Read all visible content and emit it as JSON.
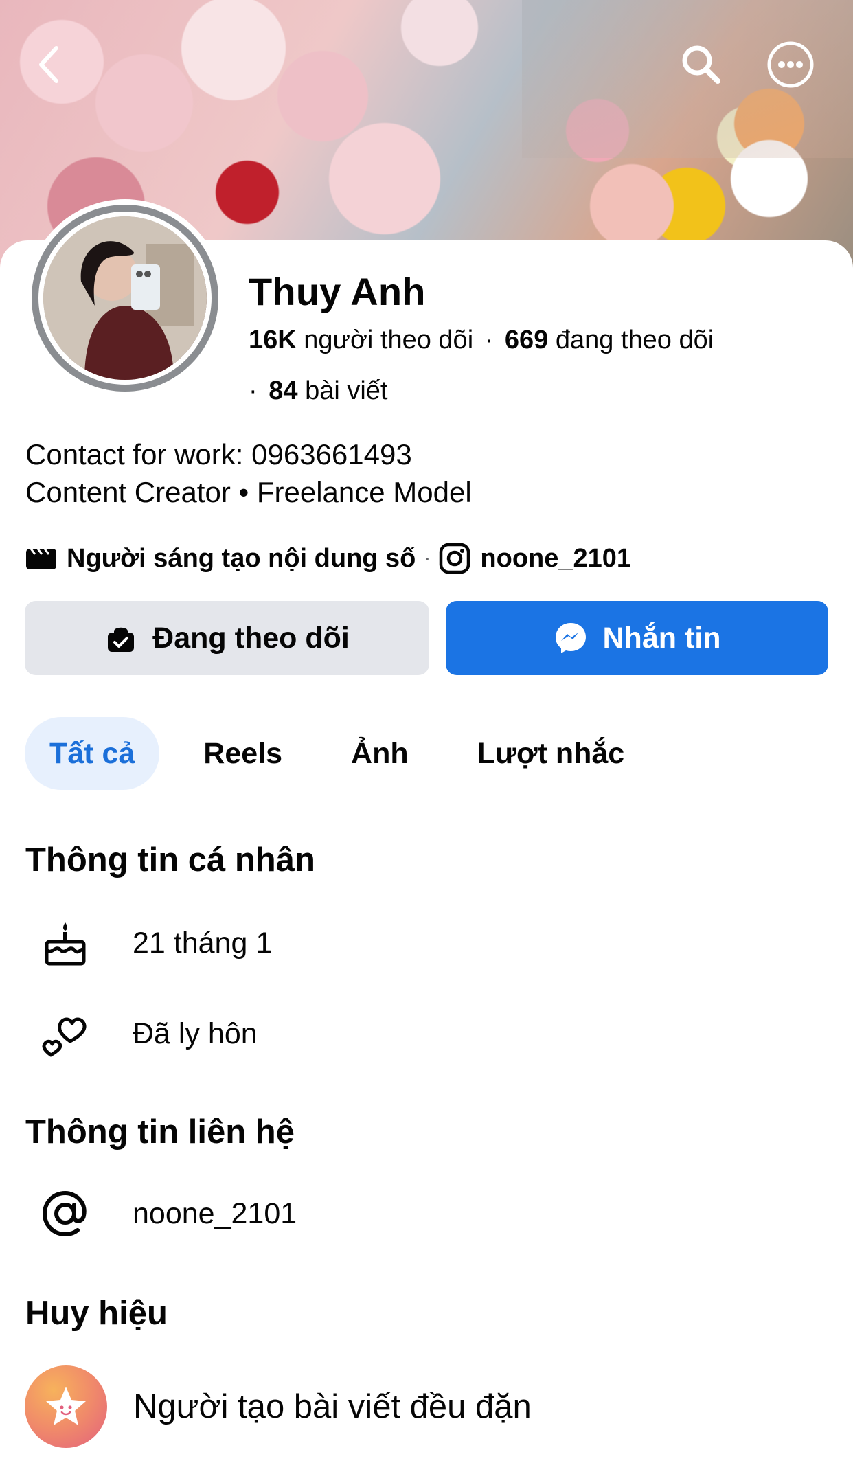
{
  "header": {
    "back_icon": "chevron-left-icon",
    "search_icon": "search-icon",
    "more_icon": "more-horizontal-icon"
  },
  "profile": {
    "name": "Thuy Anh",
    "followers_count": "16K",
    "followers_label": "người theo dõi",
    "following_count": "669",
    "following_label": "đang theo dõi",
    "posts_count": "84",
    "posts_label": "bài viết"
  },
  "bio": {
    "line1": "Contact for work: 0963661493",
    "line2": "Content Creator • Freelance Model"
  },
  "meta": {
    "creator_label": "Người sáng tạo nội dung số",
    "instagram_handle": "noone_2101"
  },
  "actions": {
    "following_label": "Đang theo dõi",
    "message_label": "Nhắn tin"
  },
  "tabs": [
    {
      "label": "Tất cả",
      "active": true
    },
    {
      "label": "Reels",
      "active": false
    },
    {
      "label": "Ảnh",
      "active": false
    },
    {
      "label": "Lượt nhắc",
      "active": false
    }
  ],
  "personal_info": {
    "title": "Thông tin cá nhân",
    "birthday": "21 tháng 1",
    "relationship": "Đã ly hôn"
  },
  "contact_info": {
    "title": "Thông tin liên hệ",
    "handle": "noone_2101"
  },
  "badges": {
    "title": "Huy hiệu",
    "item": "Người tạo bài viết đều đặn"
  },
  "colors": {
    "primary_blue": "#1b74e4",
    "tab_active_bg": "#e7f0fd",
    "tab_active_text": "#1b6fd9",
    "secondary_button_bg": "#e4e6eb"
  }
}
